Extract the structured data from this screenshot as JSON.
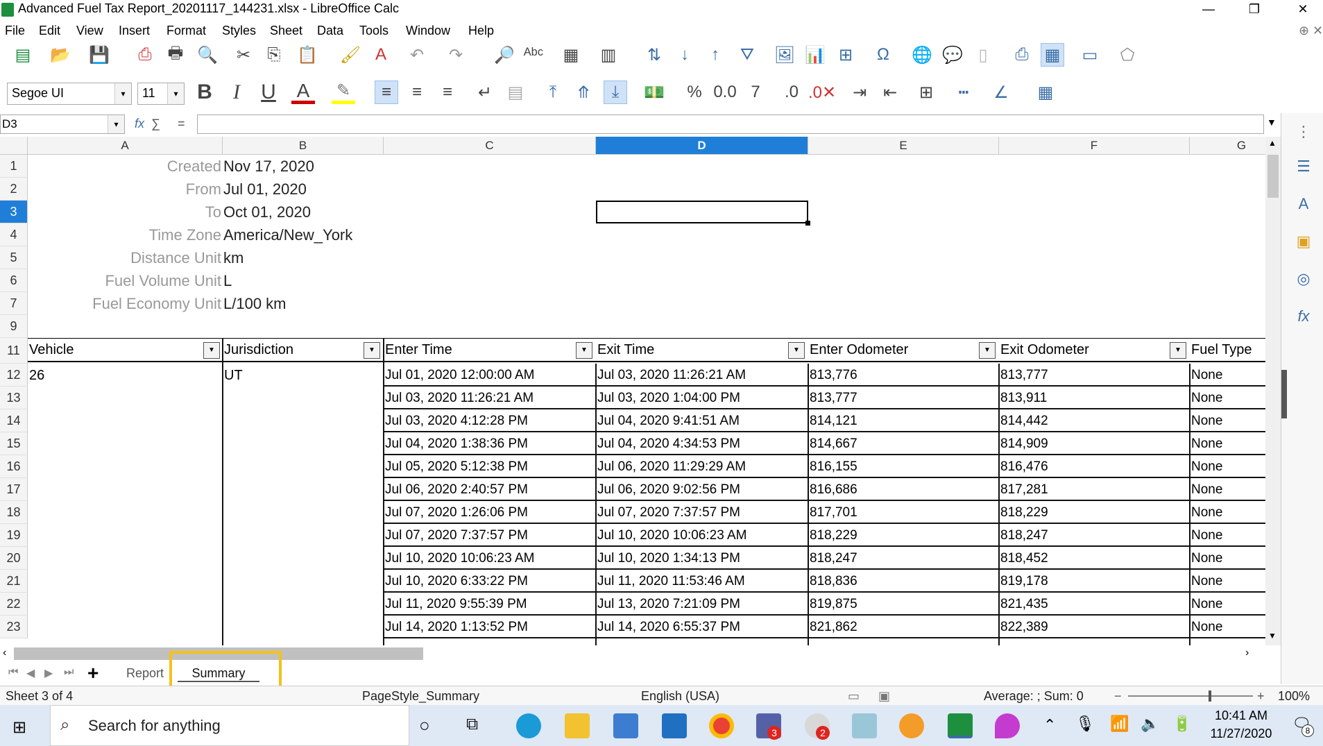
{
  "window": {
    "title": "Advanced Fuel Tax Report_20201117_144231.xlsx - LibreOffice Calc"
  },
  "menu": [
    "File",
    "Edit",
    "View",
    "Insert",
    "Format",
    "Styles",
    "Sheet",
    "Data",
    "Tools",
    "Window",
    "Help"
  ],
  "format": {
    "font_name": "Segoe UI",
    "font_size": "11"
  },
  "formula": {
    "name_box": "D3",
    "fx": "fx",
    "sum": "∑",
    "eq": "="
  },
  "columns": [
    "A",
    "B",
    "C",
    "D",
    "E",
    "F",
    "G"
  ],
  "info_rows": [
    {
      "row": "1",
      "label": "Created",
      "value": "Nov 17, 2020"
    },
    {
      "row": "2",
      "label": "From",
      "value": "Jul 01, 2020"
    },
    {
      "row": "3",
      "label": "To",
      "value": "Oct 01, 2020"
    },
    {
      "row": "4",
      "label": "Time Zone",
      "value": "America/New_York"
    },
    {
      "row": "5",
      "label": "Distance Unit",
      "value": "km"
    },
    {
      "row": "6",
      "label": "Fuel Volume Unit",
      "value": "L"
    },
    {
      "row": "7",
      "label": "Fuel Economy Unit",
      "value": "L/100 km"
    }
  ],
  "row_numbers": [
    "1",
    "2",
    "3",
    "4",
    "5",
    "6",
    "7",
    "9",
    "11",
    "12",
    "13",
    "14",
    "15",
    "16",
    "17",
    "18",
    "19",
    "20",
    "21",
    "22",
    "23"
  ],
  "table": {
    "headers": [
      "Vehicle",
      "Jurisdiction",
      "Enter Time",
      "Exit Time",
      "Enter Odometer",
      "Exit Odometer",
      "Fuel Type"
    ],
    "vehicle": "26",
    "jurisdiction": "UT",
    "rows": [
      [
        "Jul 01, 2020 12:00:00 AM",
        "Jul 03, 2020 11:26:21 AM",
        "813,776",
        "813,777",
        "None"
      ],
      [
        "Jul 03, 2020 11:26:21 AM",
        "Jul 03, 2020 1:04:00 PM",
        "813,777",
        "813,911",
        "None"
      ],
      [
        "Jul 03, 2020 4:12:28 PM",
        "Jul 04, 2020 9:41:51 AM",
        "814,121",
        "814,442",
        "None"
      ],
      [
        "Jul 04, 2020 1:38:36 PM",
        "Jul 04, 2020 4:34:53 PM",
        "814,667",
        "814,909",
        "None"
      ],
      [
        "Jul 05, 2020 5:12:38 PM",
        "Jul 06, 2020 11:29:29 AM",
        "816,155",
        "816,476",
        "None"
      ],
      [
        "Jul 06, 2020 2:40:57 PM",
        "Jul 06, 2020 9:02:56 PM",
        "816,686",
        "817,281",
        "None"
      ],
      [
        "Jul 07, 2020 1:26:06 PM",
        "Jul 07, 2020 7:37:57 PM",
        "817,701",
        "818,229",
        "None"
      ],
      [
        "Jul 07, 2020 7:37:57 PM",
        "Jul 10, 2020 10:06:23 AM",
        "818,229",
        "818,247",
        "None"
      ],
      [
        "Jul 10, 2020 10:06:23 AM",
        "Jul 10, 2020 1:34:13 PM",
        "818,247",
        "818,452",
        "None"
      ],
      [
        "Jul 10, 2020 6:33:22 PM",
        "Jul 11, 2020 11:53:46 AM",
        "818,836",
        "819,178",
        "None"
      ],
      [
        "Jul 11, 2020 9:55:39 PM",
        "Jul 13, 2020 7:21:09 PM",
        "819,875",
        "821,435",
        "None"
      ],
      [
        "Jul 14, 2020 1:13:52 PM",
        "Jul 14, 2020 6:55:37 PM",
        "821,862",
        "822,389",
        "None"
      ]
    ]
  },
  "sheets": {
    "add": "+",
    "tabs": [
      "Report",
      "Summary"
    ],
    "active": "Summary"
  },
  "status": {
    "sheet": "Sheet 3 of 4",
    "page_style": "PageStyle_Summary",
    "language": "English (USA)",
    "summary": "Average: ; Sum: 0",
    "zoom": "100%"
  },
  "taskbar": {
    "search": "Search for anything",
    "time": "10:41 AM",
    "date": "11/27/2020",
    "badge_a": "3",
    "badge_b": "2",
    "notif": "8"
  }
}
